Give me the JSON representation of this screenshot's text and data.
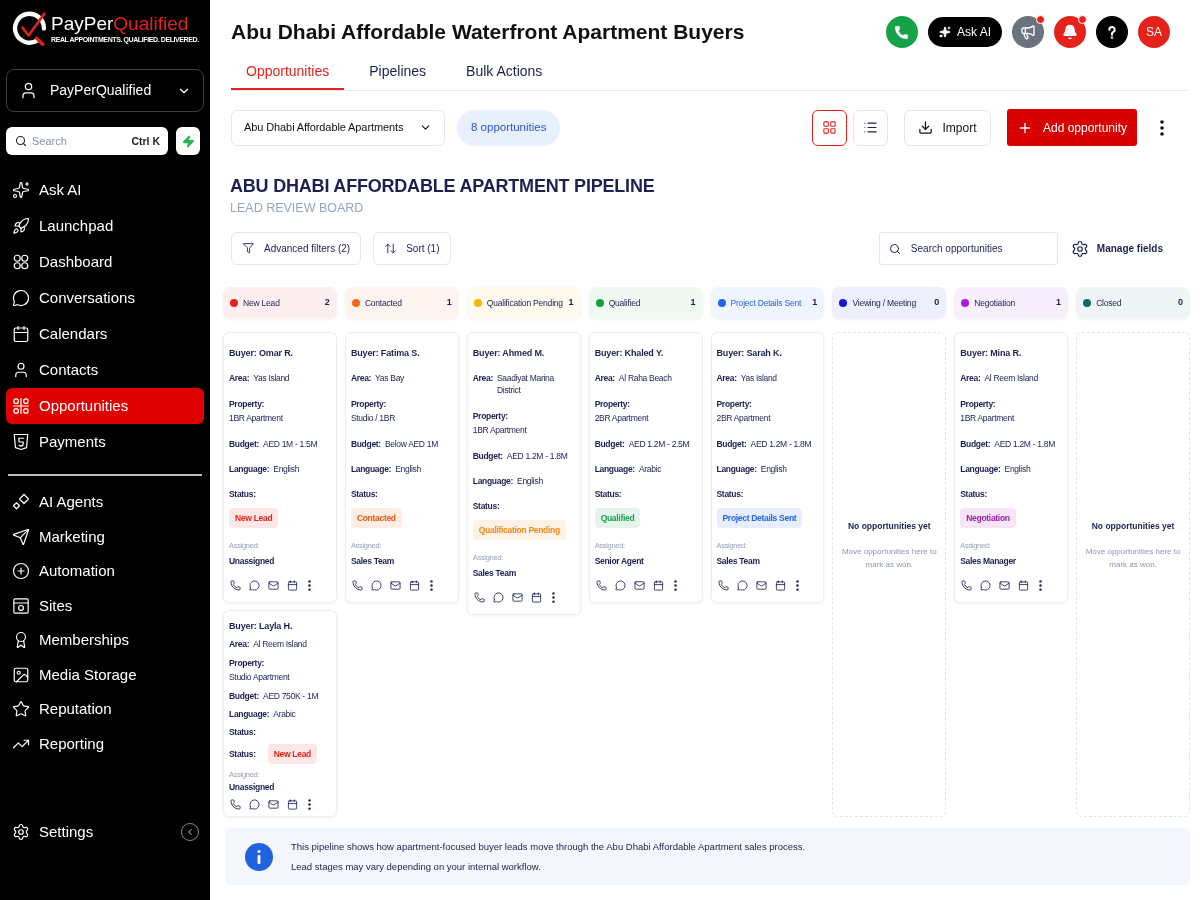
{
  "sidebar": {
    "logo": {
      "brand_start": "PayPer",
      "brand_end": "Qualified",
      "tagline": "REAL APPOINTMENTS. QUALIFIED. DELIVERED."
    },
    "account": {
      "name": "PayPerQualified"
    },
    "search": {
      "placeholder": "Search",
      "shortcut": "Ctrl K"
    },
    "nav_groups": [
      [
        {
          "label": "Ask AI",
          "selected": false
        },
        {
          "label": "Launchpad",
          "selected": false
        },
        {
          "label": "Dashboard",
          "selected": false
        },
        {
          "label": "Conversations",
          "selected": false
        },
        {
          "label": "Calendars",
          "selected": false
        },
        {
          "label": "Contacts",
          "selected": false
        },
        {
          "label": "Opportunities",
          "selected": true
        },
        {
          "label": "Payments",
          "selected": false
        }
      ],
      [
        {
          "label": "AI Agents",
          "selected": false
        },
        {
          "label": "Marketing",
          "selected": false
        },
        {
          "label": "Automation",
          "selected": false
        },
        {
          "label": "Sites",
          "selected": false
        },
        {
          "label": "Memberships",
          "selected": false
        },
        {
          "label": "Media Storage",
          "selected": false
        },
        {
          "label": "Reputation",
          "selected": false
        },
        {
          "label": "Reporting",
          "selected": false
        }
      ]
    ],
    "settings": {
      "label": "Settings",
      "selected": false
    }
  },
  "header": {
    "title": "Abu Dhabi Affordable Waterfront Apartment Buyers",
    "actions": [
      {
        "kind": "call"
      },
      {
        "kind": "ask_ai",
        "label": "Ask AI"
      },
      {
        "kind": "announcements",
        "has_notification": true
      },
      {
        "kind": "notifications",
        "has_notification": true
      },
      {
        "kind": "help"
      },
      {
        "kind": "profile",
        "initials": "SA"
      }
    ]
  },
  "tabs": [
    {
      "label": "Opportunities",
      "selected": true
    },
    {
      "label": "Pipelines",
      "selected": false
    },
    {
      "label": "Bulk Actions",
      "selected": false
    }
  ],
  "toolbar": {
    "pipeline": "Abu Dhabi Affordable Apartments",
    "count": "8 opportunities",
    "view_modes": [
      {
        "kind": "grid",
        "selected": true
      },
      {
        "kind": "list",
        "selected": false
      }
    ],
    "import_label": "Import",
    "add_label": "Add opportunity"
  },
  "board": {
    "title": "ABU DHABI AFFORDABLE APARTMENT PIPELINE",
    "subtitle": "LEAD REVIEW BOARD",
    "filters": [
      {
        "kind": "filter",
        "label": "Advanced filters (2)"
      },
      {
        "kind": "sort",
        "label": "Sort (1)"
      }
    ],
    "search": {
      "placeholder": "Search opportunities"
    },
    "manage_fields": "Manage fields",
    "columns": [
      {
        "name": "New Lead",
        "count": "2",
        "color": "#e5231b",
        "highlighted": false,
        "cards": [
          {
            "kind": "standard",
            "buyer": "Buyer: Omar R.",
            "fields": [
              {
                "kind": "inline",
                "label": "Area:",
                "value": "Yas Island"
              },
              {
                "kind": "stacked",
                "label": "Property:",
                "value": "1BR Apartment"
              },
              {
                "kind": "inline",
                "label": "Budget:",
                "value": "AED 1M - 1.5M"
              },
              {
                "kind": "inline",
                "label": "Language:",
                "value": "English"
              }
            ],
            "status": {
              "kind": "stacked",
              "label": "Status:",
              "text": "New Lead",
              "color": "#e5231b"
            },
            "assigned_label": "Assigned:",
            "assigned": "Unassigned"
          },
          {
            "kind": "compact",
            "buyer": "Buyer: Layla H.",
            "fields": [
              {
                "kind": "inline",
                "label": "Area:",
                "value": "Al Reem Island"
              },
              {
                "kind": "stacked",
                "label": "Property:",
                "value": "Studio Apartment"
              },
              {
                "kind": "inline",
                "label": "Budget:",
                "value": "AED 750K - 1M"
              },
              {
                "kind": "inline",
                "label": "Language:",
                "value": "Arabic"
              },
              {
                "kind": "label_only",
                "label": "Status:"
              }
            ],
            "status": {
              "kind": "inline",
              "label": "Status:",
              "text": "New Lead",
              "color": "#e5231b"
            },
            "assigned_label": "Assigned:",
            "assigned": "Unassigned"
          }
        ]
      },
      {
        "name": "Contacted",
        "count": "1",
        "color": "#f2691b",
        "highlighted": false,
        "cards": [
          {
            "kind": "standard",
            "buyer": "Buyer: Fatima S.",
            "fields": [
              {
                "kind": "inline",
                "label": "Area:",
                "value": "Yas Bay"
              },
              {
                "kind": "stacked",
                "label": "Property:",
                "value": "Studio / 1BR"
              },
              {
                "kind": "inline",
                "label": "Budget:",
                "value": "Below AED 1M"
              },
              {
                "kind": "inline",
                "label": "Language:",
                "value": "English"
              }
            ],
            "status": {
              "kind": "stacked",
              "label": "Status:",
              "text": "Contacted",
              "color": "#ea580c"
            },
            "assigned_label": "Assigned:",
            "assigned": "Sales Team"
          }
        ]
      },
      {
        "name": "Qualification Pending",
        "count": "1",
        "color": "#f5b70a",
        "highlighted": false,
        "cards": [
          {
            "kind": "standard",
            "buyer": "Buyer: Ahmed M.",
            "fields": [
              {
                "kind": "inline",
                "label": "Area:",
                "value": "Saadiyat Marina District"
              },
              {
                "kind": "stacked",
                "label": "Property:",
                "value": "1BR Apartment"
              },
              {
                "kind": "inline",
                "label": "Budget:",
                "value": "AED 1.2M - 1.8M"
              },
              {
                "kind": "inline",
                "label": "Language:",
                "value": "English"
              }
            ],
            "status": {
              "kind": "stacked",
              "label": "Status:",
              "text": "Qualification Pending",
              "color": "#f08a12"
            },
            "assigned_label": "Assigned:",
            "assigned": "Sales Team"
          }
        ]
      },
      {
        "name": "Qualified",
        "count": "1",
        "color": "#1f9d3a",
        "highlighted": false,
        "cards": [
          {
            "kind": "standard",
            "buyer": "Buyer: Khaled Y.",
            "fields": [
              {
                "kind": "inline",
                "label": "Area:",
                "value": "Al Raha Beach"
              },
              {
                "kind": "stacked",
                "label": "Property:",
                "value": "2BR Apartment"
              },
              {
                "kind": "inline",
                "label": "Budget:",
                "value": "AED 1.2M - 2.5M"
              },
              {
                "kind": "inline",
                "label": "Language:",
                "value": "Arabic"
              }
            ],
            "status": {
              "kind": "stacked",
              "label": "Status:",
              "text": "Qualified",
              "color": "#16a34a"
            },
            "assigned_label": "Assigned:",
            "assigned": "Senior Agent"
          }
        ]
      },
      {
        "name": "Project Details Sent",
        "count": "1",
        "color": "#2563eb",
        "highlighted": true,
        "cards": [
          {
            "kind": "standard",
            "buyer": "Buyer: Sarah K.",
            "fields": [
              {
                "kind": "inline",
                "label": "Area:",
                "value": "Yas Island"
              },
              {
                "kind": "stacked",
                "label": "Property:",
                "value": "2BR Apartment"
              },
              {
                "kind": "inline",
                "label": "Budget:",
                "value": "AED 1.2M - 1.8M"
              },
              {
                "kind": "inline",
                "label": "Language:",
                "value": "English"
              }
            ],
            "status": {
              "kind": "stacked",
              "label": "Status:",
              "text": "Project Details Sent",
              "color": "#2563eb"
            },
            "assigned_label": "Assigned:",
            "assigned": "Sales Team"
          }
        ]
      },
      {
        "name": "Viewing / Meeting",
        "count": "0",
        "color": "#1515d6",
        "highlighted": false,
        "empty": {
          "title": "No opportunities yet",
          "text": "Move opportunities here to mark as won."
        }
      },
      {
        "name": "Negotiation",
        "count": "1",
        "color": "#a21ee0",
        "highlighted": false,
        "cards": [
          {
            "kind": "standard",
            "buyer": "Buyer: Mina R.",
            "fields": [
              {
                "kind": "inline",
                "label": "Area:",
                "value": "Al Reem Island"
              },
              {
                "kind": "stacked",
                "label": "Property:",
                "value": "1BR Apartment"
              },
              {
                "kind": "inline",
                "label": "Budget:",
                "value": "AED 1.2M - 1.8M"
              },
              {
                "kind": "inline",
                "label": "Language:",
                "value": "English"
              }
            ],
            "status": {
              "kind": "stacked",
              "label": "Status:",
              "text": "Negotiation",
              "color": "#a21caf"
            },
            "assigned_label": "Assigned:",
            "assigned": "Sales Manager"
          }
        ]
      },
      {
        "name": "Closed",
        "count": "0",
        "color": "#0d6b64",
        "highlighted": false,
        "empty": {
          "title": "No opportunities yet",
          "text": "Move opportunities here to mark as won."
        }
      }
    ]
  },
  "info": {
    "lines": [
      "This pipeline shows how apartment-focused buyer leads move through the Abu Dhabi Affordable Apartment sales process.",
      "Lead stages may vary depending on your internal workflow."
    ]
  }
}
